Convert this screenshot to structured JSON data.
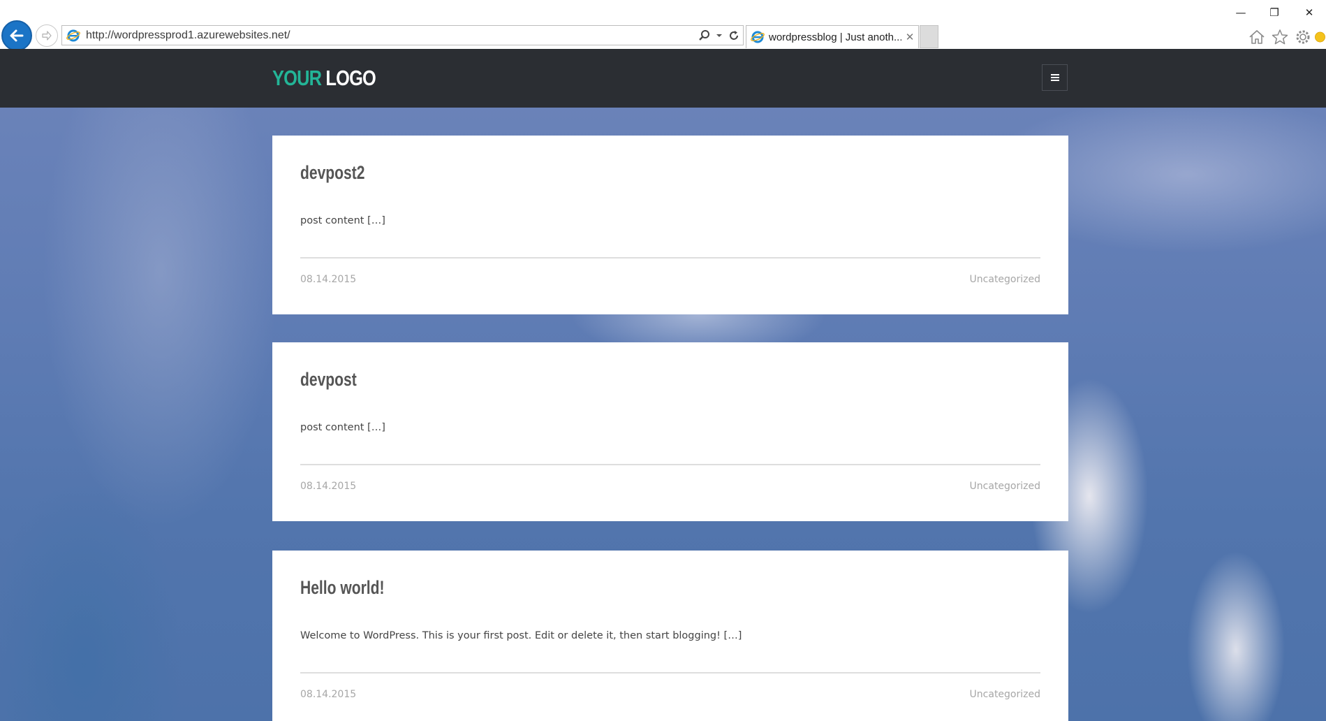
{
  "browser": {
    "url": "http://wordpressprod1.azurewebsites.net/",
    "tab_title": "wordpressblog | Just anoth...",
    "window_controls": {
      "minimize": "—",
      "maximize": "❐",
      "close": "✕"
    },
    "tab_close": "✕",
    "icons": [
      "back-icon",
      "forward-icon",
      "ie-icon",
      "search-icon",
      "refresh-icon",
      "home-icon",
      "favorites-star-icon",
      "settings-gear-icon",
      "feedback-smiley-icon"
    ]
  },
  "site": {
    "logo_part1": "YOUR",
    "logo_part2": "LOGO",
    "accent_color": "#23b597",
    "header_bg": "#2b2e33"
  },
  "posts": [
    {
      "title": "devpost2",
      "excerpt": "post content […]",
      "date": "08.14.2015",
      "category": "Uncategorized"
    },
    {
      "title": "devpost",
      "excerpt": "post content […]",
      "date": "08.14.2015",
      "category": "Uncategorized"
    },
    {
      "title": "Hello world!",
      "excerpt": "Welcome to WordPress. This is your first post. Edit or delete it, then start blogging! […]",
      "date": "08.14.2015",
      "category": "Uncategorized"
    }
  ]
}
